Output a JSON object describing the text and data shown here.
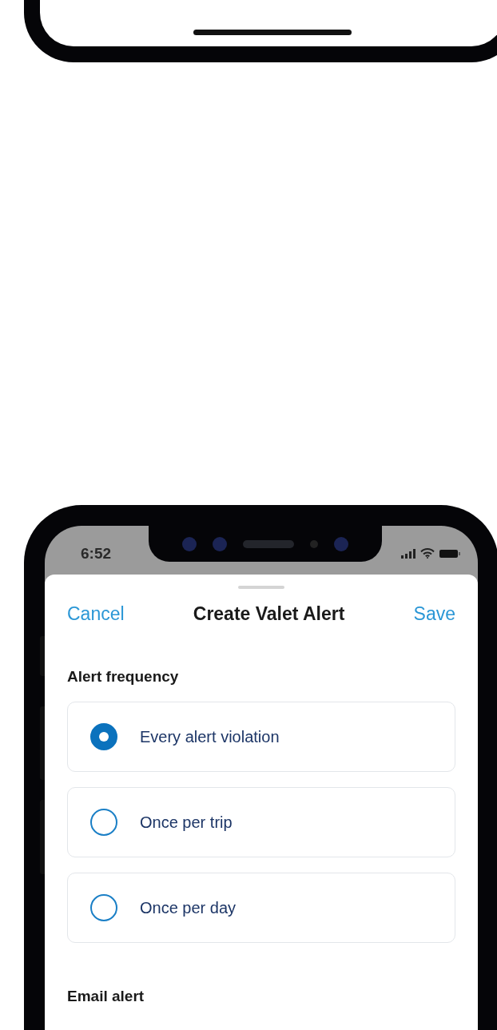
{
  "status_bar": {
    "time": "6:52"
  },
  "header": {
    "cancel": "Cancel",
    "title": "Create Valet Alert",
    "save": "Save"
  },
  "sections": [
    {
      "heading": "Alert frequency",
      "options": [
        {
          "label": "Every alert violation",
          "selected": true
        },
        {
          "label": "Once per trip",
          "selected": false
        },
        {
          "label": "Once per day",
          "selected": false
        }
      ]
    },
    {
      "heading": "Email alert"
    }
  ]
}
